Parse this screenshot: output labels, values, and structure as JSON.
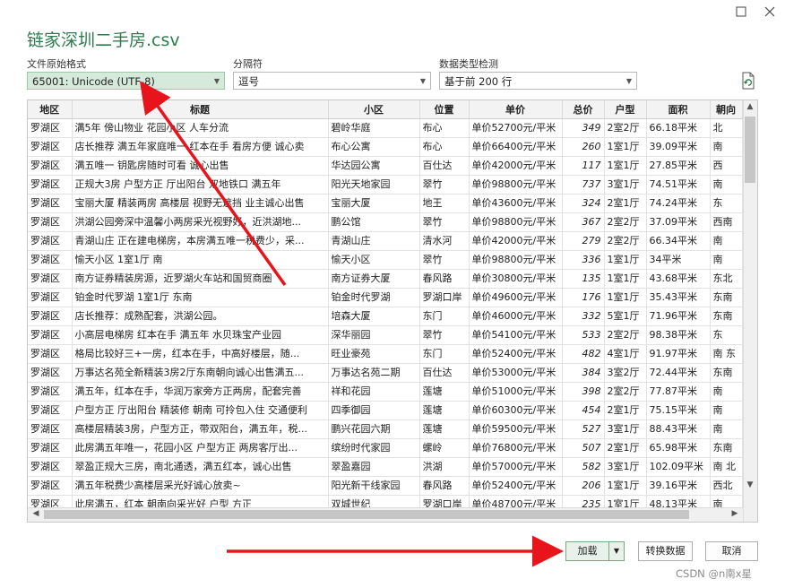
{
  "window": {
    "title": "链家深圳二手房.csv",
    "minimize_icon": "minimize-icon",
    "close_icon": "close-icon"
  },
  "controls": {
    "file_origin": {
      "label": "文件原始格式",
      "value": "65001: Unicode (UTF-8)"
    },
    "delimiter": {
      "label": "分隔符",
      "value": "逗号"
    },
    "type_detection": {
      "label": "数据类型检测",
      "value": "基于前 200 行"
    },
    "refresh_icon": "refresh-icon"
  },
  "table": {
    "columns": [
      "地区",
      "标题",
      "小区",
      "位置",
      "单价",
      "总价",
      "户型",
      "面积",
      "朝向"
    ],
    "rows": [
      [
        "罗湖区",
        "满5年 傍山物业 花园小区 人车分流",
        "碧岭华庭",
        "布心",
        "单价52700元/平米",
        "349",
        "2室2厅",
        "66.18平米",
        "北"
      ],
      [
        "罗湖区",
        "店长推荐 满五年家庭唯一 红本在手 看房方便 诚心卖",
        "布心公寓",
        "布心",
        "单价66400元/平米",
        "260",
        "1室1厅",
        "39.09平米",
        "南"
      ],
      [
        "罗湖区",
        "满五唯一 钥匙房随时可看 诚心出售",
        "华达园公寓",
        "百仕达",
        "单价42000元/平米",
        "117",
        "1室1厅",
        "27.85平米",
        "西"
      ],
      [
        "罗湖区",
        "正规大3房 户型方正 厅出阳台 双地铁口 满五年",
        "阳光天地家园",
        "翠竹",
        "单价98800元/平米",
        "737",
        "3室1厅",
        "74.51平米",
        "南"
      ],
      [
        "罗湖区",
        "宝丽大厦 精装两房 高楼层 视野无遮挡 业主诚心出售",
        "宝丽大厦",
        "地王",
        "单价43600元/平米",
        "324",
        "2室1厅",
        "74.24平米",
        "东"
      ],
      [
        "罗湖区",
        "洪湖公园旁深中温馨小两房采光视野好，近洪湖地...",
        "鹏公馆",
        "翠竹",
        "单价98800元/平米",
        "367",
        "2室2厅",
        "37.09平米",
        "西南"
      ],
      [
        "罗湖区",
        "青湖山庄 正在建电梯房，本房满五唯一税费少，采...",
        "青湖山庄",
        "清水河",
        "单价42000元/平米",
        "279",
        "2室2厅",
        "66.34平米",
        "南"
      ],
      [
        "罗湖区",
        "愉天小区 1室1厅 南",
        "愉天小区",
        "翠竹",
        "单价98800元/平米",
        "336",
        "1室1厅",
        "34平米",
        "南"
      ],
      [
        "罗湖区",
        "南方证券精装房源，近罗湖火车站和国贸商圈",
        "南方证券大厦",
        "春风路",
        "单价30800元/平米",
        "135",
        "1室1厅",
        "43.68平米",
        "东北"
      ],
      [
        "罗湖区",
        "铂金时代罗湖 1室1厅 东南",
        "铂金时代罗湖",
        "罗湖口岸",
        "单价49600元/平米",
        "176",
        "1室1厅",
        "35.43平米",
        "东南"
      ],
      [
        "罗湖区",
        "店长推荐：成熟配套，洪湖公园。",
        "培森大厦",
        "东门",
        "单价46000元/平米",
        "332",
        "5室1厅",
        "71.96平米",
        "东南"
      ],
      [
        "罗湖区",
        "小高层电梯房 红本在手 满五年 水贝珠宝产业园",
        "深华丽园",
        "翠竹",
        "单价54100元/平米",
        "533",
        "2室2厅",
        "98.38平米",
        "东"
      ],
      [
        "罗湖区",
        "格局比较好三+一房，红本在手，中高好楼层，随...",
        "旺业豪苑",
        "东门",
        "单价52400元/平米",
        "482",
        "4室1厅",
        "91.97平米",
        "南 东"
      ],
      [
        "罗湖区",
        "万事达名苑全新精装3房2厅东南朝向诚心出售满五...",
        "万事达名苑二期",
        "百仕达",
        "单价53000元/平米",
        "384",
        "3室2厅",
        "72.44平米",
        "东南"
      ],
      [
        "罗湖区",
        "满五年，红本在手，华润万家旁方正两房，配套完善",
        "祥和花园",
        "莲塘",
        "单价51000元/平米",
        "398",
        "2室2厅",
        "77.87平米",
        "南"
      ],
      [
        "罗湖区",
        "户型方正 厅出阳台 精装修 朝南 可拎包入住 交通便利",
        "四季御园",
        "莲塘",
        "单价60300元/平米",
        "454",
        "2室1厅",
        "75.15平米",
        "南"
      ],
      [
        "罗湖区",
        "高楼层精装3房，户型方正，带双阳台，满五年，税...",
        "鹏兴花园六期",
        "莲塘",
        "单价59500元/平米",
        "527",
        "3室1厅",
        "88.43平米",
        "南"
      ],
      [
        "罗湖区",
        "此房满五年唯一，花园小区 户型方正 两房客厅出...",
        "缤纷时代家园",
        "螺岭",
        "单价76800元/平米",
        "507",
        "2室1厅",
        "65.98平米",
        "东南"
      ],
      [
        "罗湖区",
        "翠盈正规大三房，南北通透，满五红本，诚心出售",
        "翠盈嘉园",
        "洪湖",
        "单价57000元/平米",
        "582",
        "3室1厅",
        "102.09平米",
        "南 北"
      ],
      [
        "罗湖区",
        "满五年税费少高楼层采光好诚心放卖~",
        "阳光新干线家园",
        "春风路",
        "单价52400元/平米",
        "206",
        "1室1厅",
        "39.16平米",
        "西北"
      ],
      [
        "罗湖区",
        "此房满五，红本 朝南向采光好 户型 方正",
        "双城世纪",
        "罗湖口岸",
        "单价48700元/平米",
        "235",
        "1室1厅",
        "48.13平米",
        "南"
      ]
    ]
  },
  "buttons": {
    "load": "加载",
    "transform": "转换数据",
    "cancel": "取消"
  },
  "watermark": "CSDN @n南x星",
  "annotation_color": "#e8141b"
}
